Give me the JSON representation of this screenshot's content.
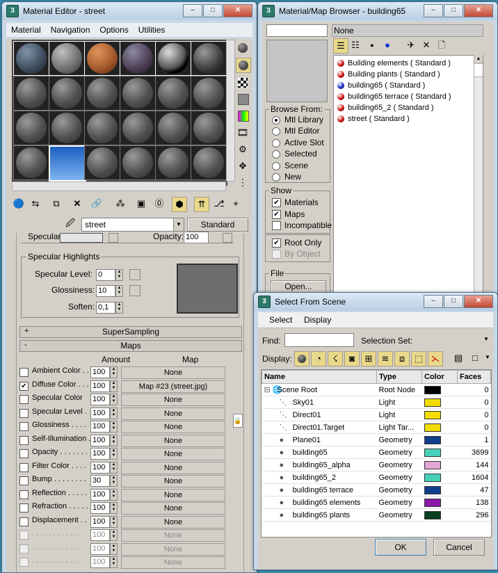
{
  "material_editor": {
    "title": "Material Editor - street",
    "menu": [
      "Material",
      "Navigation",
      "Options",
      "Utilities"
    ],
    "material_name": "street",
    "material_type": "Standard",
    "partial": {
      "specular_label": "Specular:",
      "opacity_label": "Opacity:",
      "opacity_value": "100"
    },
    "specular_highlights": {
      "title": "Specular Highlights",
      "specular_level_label": "Specular Level:",
      "specular_level": "0",
      "glossiness_label": "Glossiness:",
      "glossiness": "10",
      "soften_label": "Soften:",
      "soften": "0,1"
    },
    "rollouts": {
      "supersampling": "SuperSampling",
      "maps": "Maps",
      "plus": "+",
      "minus": "-"
    },
    "maps_header": {
      "amount": "Amount",
      "map": "Map"
    },
    "maps": [
      {
        "label": "Ambient Color . .",
        "amount": "100",
        "map": "None",
        "checked": false,
        "enabled": true
      },
      {
        "label": "Diffuse Color . . .",
        "amount": "100",
        "map": "Map #23 (street.jpg)",
        "checked": true,
        "enabled": true
      },
      {
        "label": "Specular Color",
        "amount": "100",
        "map": "None",
        "checked": false,
        "enabled": true
      },
      {
        "label": "Specular Level .",
        "amount": "100",
        "map": "None",
        "checked": false,
        "enabled": true
      },
      {
        "label": "Glossiness . . . .",
        "amount": "100",
        "map": "None",
        "checked": false,
        "enabled": true
      },
      {
        "label": "Self-Illumination .",
        "amount": "100",
        "map": "None",
        "checked": false,
        "enabled": true
      },
      {
        "label": "Opacity . . . . . . .",
        "amount": "100",
        "map": "None",
        "checked": false,
        "enabled": true
      },
      {
        "label": "Filter Color . . . .",
        "amount": "100",
        "map": "None",
        "checked": false,
        "enabled": true
      },
      {
        "label": "Bump . . . . . . . .",
        "amount": "30",
        "map": "None",
        "checked": false,
        "enabled": true
      },
      {
        "label": "Reflection . . . . .",
        "amount": "100",
        "map": "None",
        "checked": false,
        "enabled": true
      },
      {
        "label": "Refraction . . . . .",
        "amount": "100",
        "map": "None",
        "checked": false,
        "enabled": true
      },
      {
        "label": "Displacement . .",
        "amount": "100",
        "map": "None",
        "checked": false,
        "enabled": true
      },
      {
        "label": ". . . . . . . . . . . .",
        "amount": "100",
        "map": "None",
        "checked": false,
        "enabled": false
      },
      {
        "label": ". . . . . . . . . . . .",
        "amount": "100",
        "map": "None",
        "checked": false,
        "enabled": false
      },
      {
        "label": ". . . . . . . . . . . .",
        "amount": "100",
        "map": "None",
        "checked": false,
        "enabled": false
      }
    ]
  },
  "browser": {
    "title": "Material/Map Browser - building65",
    "name_field": "None",
    "browse_from": {
      "title": "Browse From:",
      "options": [
        "Mtl Library",
        "Mtl Editor",
        "Active Slot",
        "Selected",
        "Scene",
        "New"
      ],
      "selected": 0
    },
    "show": {
      "title": "Show",
      "options": [
        {
          "label": "Materials",
          "checked": true
        },
        {
          "label": "Maps",
          "checked": true
        },
        {
          "label": "Incompatible",
          "checked": false
        }
      ]
    },
    "root_only": {
      "label": "Root Only",
      "checked": true
    },
    "by_object": {
      "label": "By Object",
      "checked": false
    },
    "file": {
      "title": "File",
      "open": "Open..."
    },
    "items": [
      {
        "label": "Building elements  ( Standard )",
        "color": "#d01010"
      },
      {
        "label": "Building plants  ( Standard )",
        "color": "#d01010"
      },
      {
        "label": "building65  ( Standard )",
        "color": "#1030d0"
      },
      {
        "label": "building65 terrace  ( Standard )",
        "color": "#d01010"
      },
      {
        "label": "building65_2  ( Standard )",
        "color": "#d01010"
      },
      {
        "label": "street  ( Standard )",
        "color": "#d01010"
      }
    ]
  },
  "select_scene": {
    "title": "Select From Scene",
    "menu": [
      "Select",
      "Display"
    ],
    "find_label": "Find:",
    "find_value": "",
    "selection_set_label": "Selection Set:",
    "display_label": "Display:",
    "columns": [
      "Name",
      "Type",
      "Color",
      "Faces"
    ],
    "rows": [
      {
        "name": "Scene Root",
        "type": "Root Node",
        "color": "#000000",
        "faces": "0"
      },
      {
        "name": "Sky01",
        "type": "Light",
        "color": "#f2dc00",
        "faces": "0"
      },
      {
        "name": "Direct01",
        "type": "Light",
        "color": "#f2dc00",
        "faces": "0"
      },
      {
        "name": "Direct01.Target",
        "type": "Light Tar...",
        "color": "#f2dc00",
        "faces": "0"
      },
      {
        "name": "Plane01",
        "type": "Geometry",
        "color": "#103e8a",
        "faces": "1"
      },
      {
        "name": "building65",
        "type": "Geometry",
        "color": "#47d1b9",
        "faces": "3699"
      },
      {
        "name": "building65_alpha",
        "type": "Geometry",
        "color": "#e3a6d4",
        "faces": "144"
      },
      {
        "name": "building65_2",
        "type": "Geometry",
        "color": "#47d1b9",
        "faces": "1604"
      },
      {
        "name": "building65 terrace",
        "type": "Geometry",
        "color": "#103e8a",
        "faces": "47"
      },
      {
        "name": "building65 elements",
        "type": "Geometry",
        "color": "#8a1aa8",
        "faces": "138"
      },
      {
        "name": "building65 plants",
        "type": "Geometry",
        "color": "#0a3e1e",
        "faces": "296"
      }
    ],
    "ok": "OK",
    "cancel": "Cancel"
  }
}
